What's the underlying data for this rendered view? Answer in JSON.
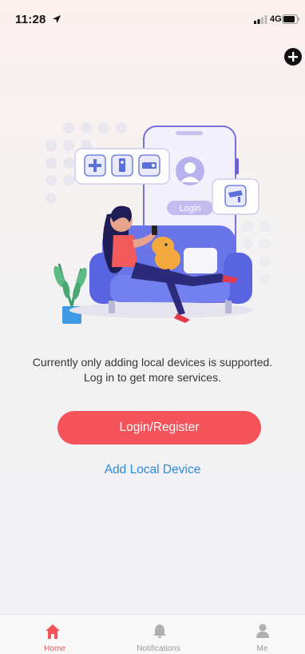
{
  "status_bar": {
    "time": "11:28",
    "network": "4G",
    "icons": [
      "location-arrow-icon",
      "signal-bars-icon",
      "battery-icon"
    ]
  },
  "header": {
    "add_icon": "plus-circle-icon"
  },
  "illustration": {
    "description_icon": "woman-on-sofa-with-phone-illustration",
    "phone_button_label": "Login"
  },
  "main": {
    "notice_line1": "Currently only adding local devices is supported.",
    "notice_line2": "Log in to get more services.",
    "login_button_label": "Login/Register",
    "add_local_label": "Add Local Device"
  },
  "tabs": [
    {
      "label": "Home",
      "icon": "home-icon",
      "active": true
    },
    {
      "label": "Notifications",
      "icon": "bell-icon",
      "active": false
    },
    {
      "label": "Me",
      "icon": "person-icon",
      "active": false
    }
  ],
  "colors": {
    "accent": "#f4535a",
    "link": "#2d8ad6",
    "inactive_tab": "#9a9a9a"
  }
}
